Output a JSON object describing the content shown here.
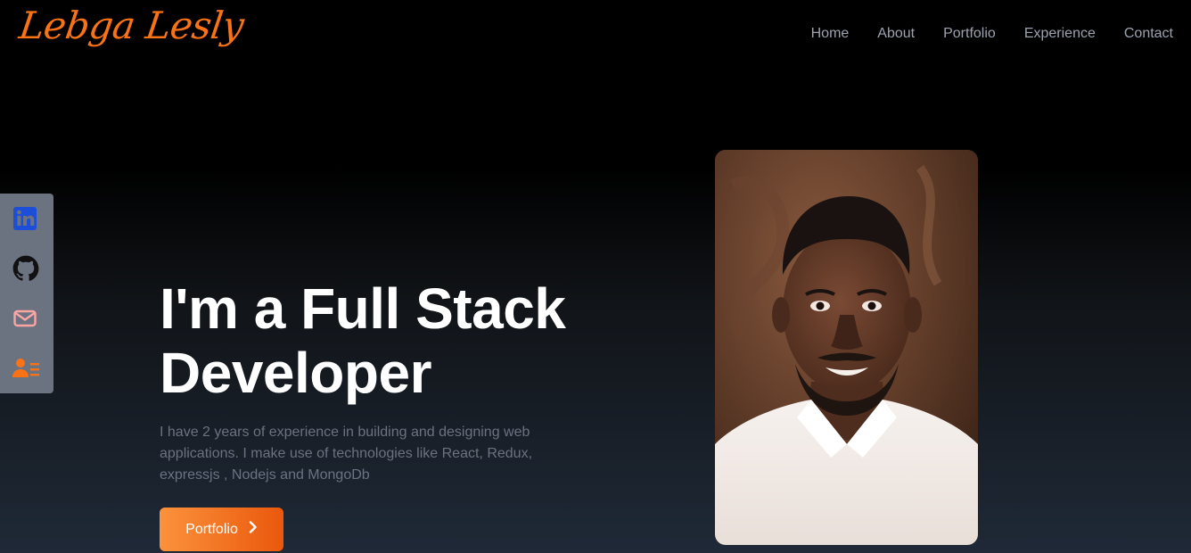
{
  "header": {
    "logo_text": "Lebga Lesly",
    "nav": [
      {
        "label": "Home"
      },
      {
        "label": "About"
      },
      {
        "label": "Portfolio"
      },
      {
        "label": "Experience"
      },
      {
        "label": "Contact"
      }
    ]
  },
  "social": [
    {
      "icon": "linkedin-icon",
      "color": "#1d4ed8"
    },
    {
      "icon": "github-icon",
      "color": "#111111"
    },
    {
      "icon": "mail-icon",
      "color": "#fca5a5"
    },
    {
      "icon": "resume-icon",
      "color": "#f97316"
    }
  ],
  "hero": {
    "line1": "I'm a Full Stack",
    "line2": "Developer",
    "bio": "I have 2 years of experience in building and designing web applications. I make use of technologies like React, Redux, expressjs , Nodejs and MongoDb",
    "button_label": "Portfolio",
    "button_icon": "chevron-right-icon"
  },
  "colors": {
    "accent": "#f97316",
    "nav_text": "#9ca3af",
    "bio_text": "#6b7280",
    "social_bar": "#6b7280"
  }
}
